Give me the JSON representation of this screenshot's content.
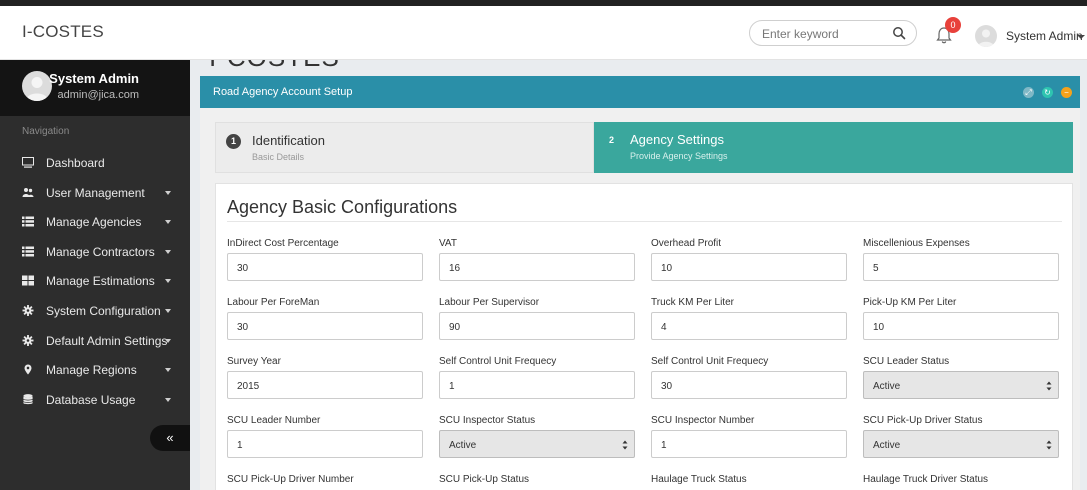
{
  "app": {
    "brand": "I-COSTES"
  },
  "topbar": {
    "search_placeholder": "Enter keyword",
    "notification_count": "0",
    "user": "System Admin"
  },
  "sidebar": {
    "profile_name": "System Admin",
    "profile_email": "admin@jica.com",
    "nav_title": "Navigation",
    "items": [
      {
        "label": "Dashboard",
        "icon": "monitor-icon",
        "has_caret": false
      },
      {
        "label": "User Management",
        "icon": "users-icon",
        "has_caret": true
      },
      {
        "label": "Manage Agencies",
        "icon": "list-icon",
        "has_caret": true
      },
      {
        "label": "Manage Contractors",
        "icon": "list-icon",
        "has_caret": true
      },
      {
        "label": "Manage Estimations",
        "icon": "table-icon",
        "has_caret": true
      },
      {
        "label": "System Configuration",
        "icon": "gear-icon",
        "has_caret": true
      },
      {
        "label": "Default Admin Settings",
        "icon": "gear-icon",
        "has_caret": true
      },
      {
        "label": "Manage Regions",
        "icon": "map-marker-icon",
        "has_caret": true
      },
      {
        "label": "Database Usage",
        "icon": "database-icon",
        "has_caret": true
      }
    ],
    "collapse_label": "«"
  },
  "content": {
    "ghost_title": "I-COSTES",
    "panel_title": "Road Agency Account Setup",
    "wizard": {
      "steps": [
        {
          "num": "1",
          "title": "Identification",
          "subtitle": "Basic Details"
        },
        {
          "num": "2",
          "title": "Agency Settings",
          "subtitle": "Provide Agency Settings"
        }
      ]
    },
    "card_title": "Agency Basic Configurations",
    "fields": [
      {
        "label": "InDirect Cost Percentage",
        "value": "30",
        "type": "input"
      },
      {
        "label": "VAT",
        "value": "16",
        "type": "input"
      },
      {
        "label": "Overhead Profit",
        "value": "10",
        "type": "input"
      },
      {
        "label": "Miscellenious Expenses",
        "value": "5",
        "type": "input"
      },
      {
        "label": "Labour Per ForeMan",
        "value": "30",
        "type": "input"
      },
      {
        "label": "Labour Per Supervisor",
        "value": "90",
        "type": "input"
      },
      {
        "label": "Truck KM Per Liter",
        "value": "4",
        "type": "input"
      },
      {
        "label": "Pick-Up KM Per Liter",
        "value": "10",
        "type": "input"
      },
      {
        "label": "Survey Year",
        "value": "2015",
        "type": "input"
      },
      {
        "label": "Self Control Unit Frequecy",
        "value": "1",
        "type": "input"
      },
      {
        "label": "Self Control Unit Frequecy",
        "value": "30",
        "type": "input"
      },
      {
        "label": "SCU Leader Status",
        "value": "Active",
        "type": "select"
      },
      {
        "label": "SCU Leader Number",
        "value": "1",
        "type": "input"
      },
      {
        "label": "SCU Inspector Status",
        "value": "Active",
        "type": "select"
      },
      {
        "label": "SCU Inspector Number",
        "value": "1",
        "type": "input"
      },
      {
        "label": "SCU Pick-Up Driver Status",
        "value": "Active",
        "type": "select"
      },
      {
        "label": "SCU Pick-Up Driver Number",
        "value": "",
        "type": "input"
      },
      {
        "label": "SCU Pick-Up Status",
        "value": "",
        "type": "input"
      },
      {
        "label": "Haulage Truck Status",
        "value": "",
        "type": "input"
      },
      {
        "label": "Haulage Truck Driver Status",
        "value": "",
        "type": "input"
      }
    ]
  },
  "colors": {
    "panel_header": "#2a8fa8",
    "active_step": "#3aa79d",
    "sidebar": "#2d2d2d",
    "notification_badge": "#e8413b"
  }
}
